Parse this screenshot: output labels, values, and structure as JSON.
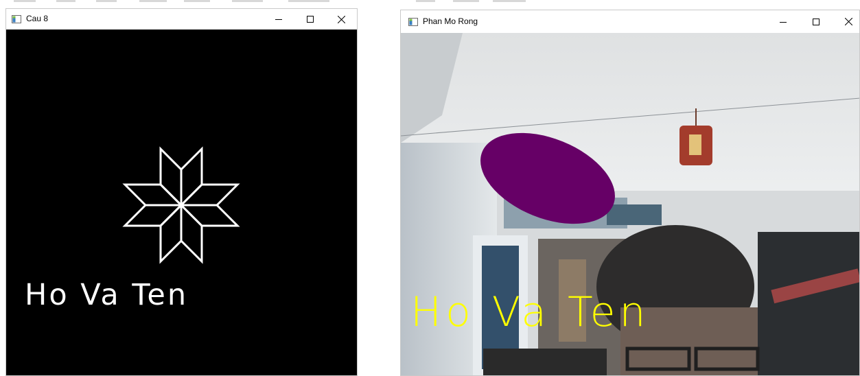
{
  "windows": [
    {
      "title": "Cau 8",
      "overlay_text": "Ho Va Ten",
      "text_color": "#ffffff",
      "background_color": "#000000",
      "shape": "star-outline"
    },
    {
      "title": "Phan Mo Rong",
      "overlay_text": "Ho Va Ten",
      "text_color": "#ffff00",
      "ellipse_color": "#660066",
      "background": "webcam-feed"
    }
  ],
  "controls": {
    "minimize_icon": "minimize-icon",
    "maximize_icon": "maximize-icon",
    "close_icon": "close-icon"
  }
}
